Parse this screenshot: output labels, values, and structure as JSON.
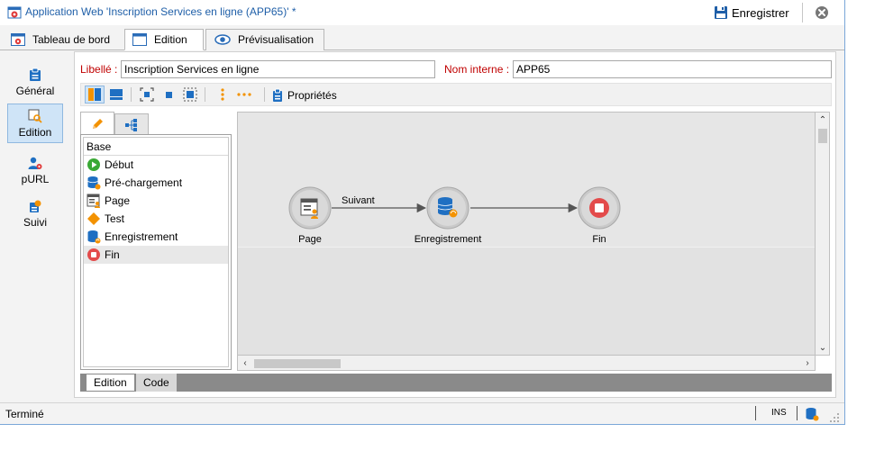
{
  "window": {
    "title": "Application Web 'Inscription Services en ligne (APP65)' *",
    "save_label": "Enregistrer"
  },
  "tabs": [
    {
      "label": "Tableau de bord"
    },
    {
      "label": "Edition"
    },
    {
      "label": "Prévisualisation"
    }
  ],
  "nav": [
    {
      "label": "Général"
    },
    {
      "label": "Edition"
    },
    {
      "label": "pURL"
    },
    {
      "label": "Suivi"
    }
  ],
  "form": {
    "libelle_label": "Libellé :",
    "libelle_value": "Inscription Services en ligne",
    "nom_label": "Nom interne :",
    "nom_value": "APP65"
  },
  "toolbar": {
    "properties_label": "Propriétés"
  },
  "palette": {
    "header": "Base",
    "items": [
      {
        "label": "Début"
      },
      {
        "label": "Pré-chargement"
      },
      {
        "label": "Page"
      },
      {
        "label": "Test"
      },
      {
        "label": "Enregistrement"
      },
      {
        "label": "Fin"
      }
    ]
  },
  "diagram": {
    "nodes": [
      {
        "label": "Page"
      },
      {
        "label": "Enregistrement"
      },
      {
        "label": "Fin"
      }
    ],
    "edges": [
      {
        "label": "Suivant"
      },
      {
        "label": ""
      }
    ]
  },
  "bottom_tabs": [
    {
      "label": "Edition"
    },
    {
      "label": "Code"
    }
  ],
  "status": {
    "text": "Terminé",
    "mode": "INS"
  },
  "colors": {
    "title_blue": "#1f5fa8",
    "required_red": "#c00000",
    "accent_orange": "#f39200",
    "accent_blue": "#1f6fc2",
    "start_green": "#3aa935",
    "end_red": "#e34b4b"
  }
}
